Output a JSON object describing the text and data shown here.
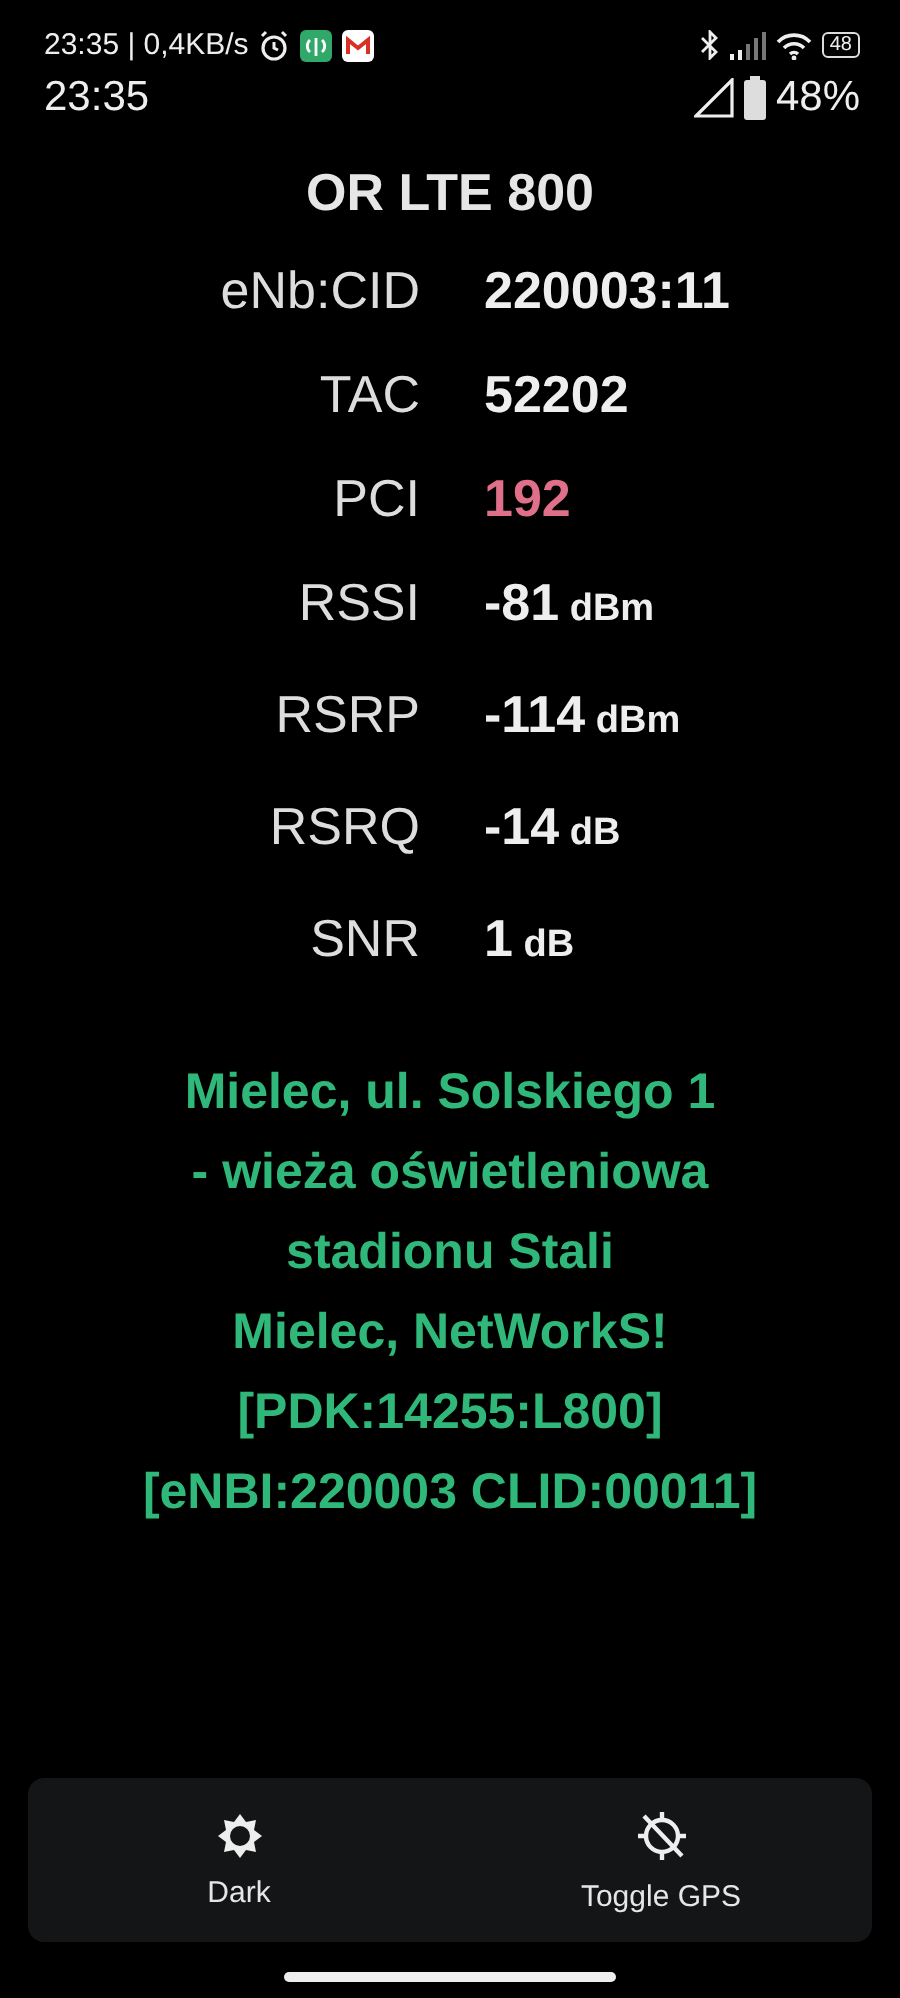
{
  "status_bar": {
    "top_text": "23:35 | 0,4KB/s",
    "battery_small": "48",
    "time": "23:35",
    "battery_percent": "48%"
  },
  "title": "OR LTE 800",
  "rows": [
    {
      "label": "eNb:CID",
      "value": "220003:11",
      "color": "#eeeeee"
    },
    {
      "label": "TAC",
      "value": "52202",
      "color": "#eeeeee"
    },
    {
      "label": "PCI",
      "value": "192",
      "color": "#e0708a"
    },
    {
      "label": "RSSI",
      "value": "-81",
      "unit": "dBm",
      "color": "#eeeeee"
    },
    {
      "label": "RSRP",
      "value": "-114",
      "unit": "dBm",
      "color": "#eeeeee"
    },
    {
      "label": "RSRQ",
      "value": "-14",
      "unit": "dB",
      "color": "#eeeeee"
    },
    {
      "label": "SNR",
      "value": "1",
      "unit": "dB",
      "color": "#eeeeee"
    }
  ],
  "location_lines": [
    "Mielec, ul. Solskiego 1",
    "- wieża oświetleniowa",
    "stadionu Stali",
    "Mielec, NetWorkS!",
    "[PDK:14255:L800]",
    "[eNBI:220003 CLID:00011]"
  ],
  "bottom_bar": [
    {
      "kind": "theme",
      "label": "Dark"
    },
    {
      "kind": "gps",
      "label": "Toggle GPS"
    }
  ]
}
